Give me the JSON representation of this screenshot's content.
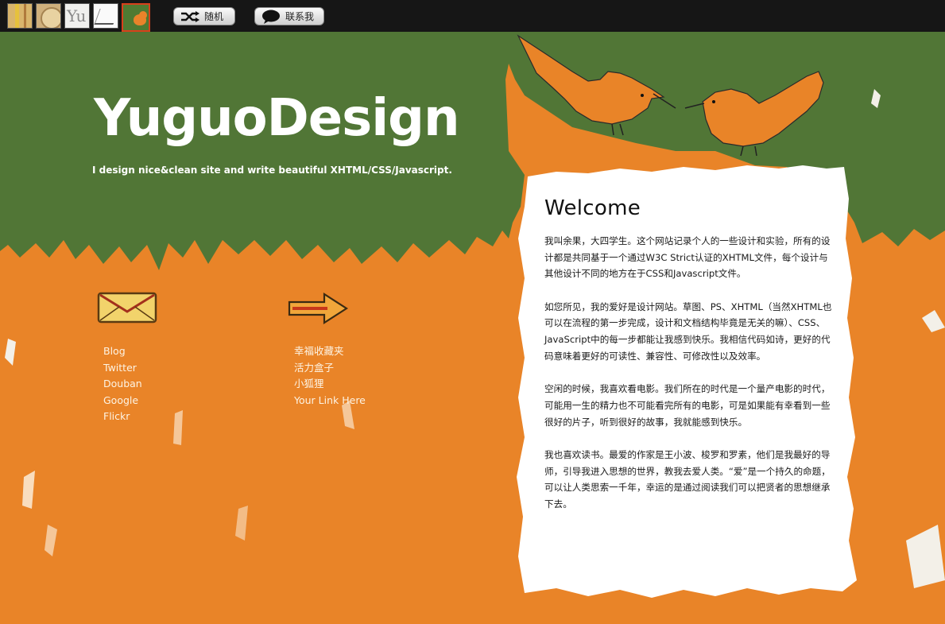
{
  "topbar": {
    "thumbs": [
      {
        "name": "theme-1",
        "label": ""
      },
      {
        "name": "theme-2",
        "label": ""
      },
      {
        "name": "theme-3",
        "label": "Yu"
      },
      {
        "name": "theme-4",
        "label": ""
      },
      {
        "name": "theme-5",
        "label": ""
      }
    ],
    "shuffle_label": "随机",
    "contact_label": "联系我"
  },
  "header": {
    "brand": "YuguoDesign",
    "tagline": "I design nice&clean site and write beautiful XHTML/CSS/Javascript."
  },
  "links_left": [
    "Blog",
    "Twitter",
    "Douban",
    "Google",
    "Flickr"
  ],
  "links_right": [
    "幸福收藏夹",
    "活力盒子",
    "小狐狸",
    "Your Link Here"
  ],
  "card": {
    "title": "Welcome",
    "paragraphs": [
      "我叫余果，大四学生。这个网站记录个人的一些设计和实验，所有的设计都是共同基于一个通过W3C Strict认证的XHTML文件，每个设计与其他设计不同的地方在于CSS和Javascript文件。",
      "如您所见，我的爱好是设计网站。草图、PS、XHTML（当然XHTML也可以在流程的第一步完成，设计和文档结构毕竟是无关的嘛）、CSS、JavaScript中的每一步都能让我感到快乐。我相信代码如诗，更好的代码意味着更好的可读性、兼容性、可修改性以及效率。",
      "空闲的时候，我喜欢看电影。我们所在的时代是一个量产电影的时代，可能用一生的精力也不可能看完所有的电影，可是如果能有幸看到一些很好的片子，听到很好的故事，我就能感到快乐。",
      "我也喜欢读书。最爱的作家是王小波、梭罗和罗素，他们是我最好的导师，引导我进入思想的世界，教我去爱人类。“爱”是一个持久的命题，可以让人类思索一千年，幸运的是通过阅读我们可以把贤者的思想继承下去。"
    ]
  },
  "colors": {
    "green": "#517636",
    "orange": "#e98428",
    "bar": "#161616"
  }
}
